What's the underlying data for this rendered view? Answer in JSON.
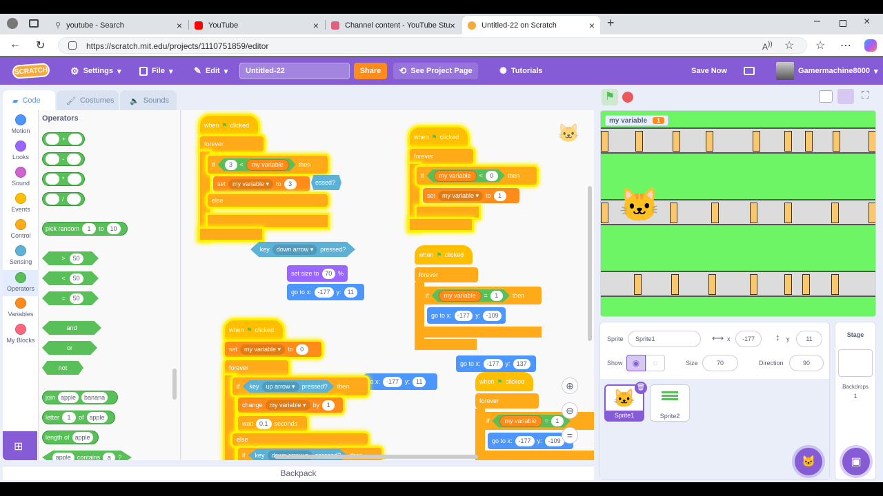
{
  "browser": {
    "tabs": [
      {
        "title": "youtube - Search"
      },
      {
        "title": "YouTube"
      },
      {
        "title": "Channel content - YouTube Studio"
      },
      {
        "title": "Untitled-22 on Scratch"
      }
    ],
    "url": "https://scratch.mit.edu/projects/1110751859/editor"
  },
  "menubar": {
    "logo": "SCRATCH",
    "settings": "Settings",
    "file": "File",
    "edit": "Edit",
    "project_title": "Untitled-22",
    "share": "Share",
    "see_project": "See Project Page",
    "tutorials": "Tutorials",
    "save_now": "Save Now",
    "username": "Gamermachine8000"
  },
  "editor_tabs": {
    "code": "Code",
    "costumes": "Costumes",
    "sounds": "Sounds"
  },
  "categories": [
    {
      "label": "Motion",
      "color": "#4c97ff"
    },
    {
      "label": "Looks",
      "color": "#9966ff"
    },
    {
      "label": "Sound",
      "color": "#cf63cf"
    },
    {
      "label": "Events",
      "color": "#ffbf00"
    },
    {
      "label": "Control",
      "color": "#ffab19"
    },
    {
      "label": "Sensing",
      "color": "#5cb1d6"
    },
    {
      "label": "Operators",
      "color": "#59c059"
    },
    {
      "label": "Variables",
      "color": "#ff8c1a"
    },
    {
      "label": "My Blocks",
      "color": "#ff6680"
    }
  ],
  "palette": {
    "heading": "Operators",
    "plus": "+",
    "minus": "-",
    "times": "*",
    "divide": "/",
    "pick_random": "pick random",
    "pick_from": "1",
    "pick_to_word": "to",
    "pick_to": "10",
    "gt": ">",
    "lt": "<",
    "eq": "=",
    "fifty": "50",
    "and": "and",
    "or": "or",
    "not": "not",
    "join": "join",
    "apple": "apple",
    "banana": "banana",
    "letter": "letter",
    "one": "1",
    "of": "of",
    "length_of": "length of",
    "contains": "contains",
    "a": "a",
    "q": "?"
  },
  "scripts": {
    "when_flag": "when",
    "clicked": "clicked",
    "forever": "forever",
    "if": "if",
    "then": "then",
    "else": "else",
    "set": "set",
    "to": "to",
    "change": "change",
    "by": "by",
    "wait": "wait",
    "seconds": "seconds",
    "key": "key",
    "pressed": "pressed?",
    "pressed_frag": "essed?",
    "my_variable": "my variable",
    "down_arrow": "down arrow",
    "up_arrow": "up arrow",
    "set_size": "set size to",
    "size_val": "70",
    "pct": "%",
    "goto_x": "go to x:",
    "goto_x_frag": "to x:",
    "y": "y:",
    "v3": "3",
    "v0": "0",
    "v1": "1",
    "v01": "0.1",
    "lt": "<",
    "eq": "=",
    "xm177": "-177",
    "y11": "11",
    "ym109": "-109",
    "y137": "137",
    "ym109_frag": "-109"
  },
  "bottombar": {
    "backpack": "Backpack"
  },
  "stage": {
    "monitor_label": "my variable",
    "monitor_value": "1"
  },
  "sprite_info": {
    "sprite_label": "Sprite",
    "sprite_name": "Sprite1",
    "x_label": "x",
    "x_value": "-177",
    "y_label": "y",
    "y_value": "11",
    "show_label": "Show",
    "size_label": "Size",
    "size_value": "70",
    "direction_label": "Direction",
    "direction_value": "90"
  },
  "sprites": [
    {
      "name": "Sprite1"
    },
    {
      "name": "Sprite2"
    }
  ],
  "stage_pane": {
    "title": "Stage",
    "backdrops_label": "Backdrops",
    "backdrops_count": "1"
  }
}
